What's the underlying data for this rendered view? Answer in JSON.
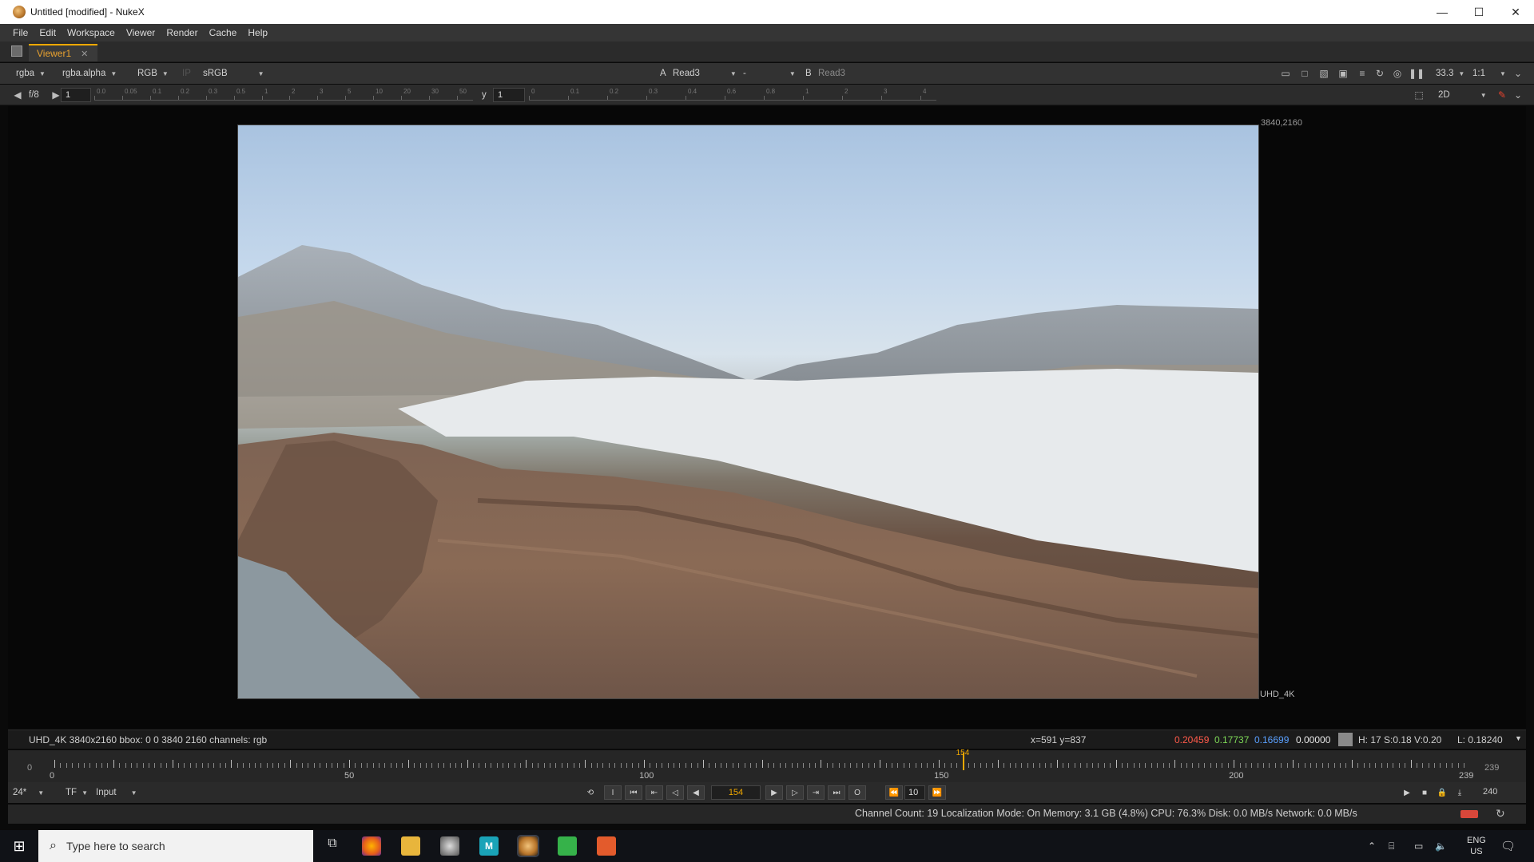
{
  "window": {
    "title": "Untitled [modified] - NukeX",
    "min": "—",
    "max": "☐",
    "close": "✕"
  },
  "menu": [
    "File",
    "Edit",
    "Workspace",
    "Viewer",
    "Render",
    "Cache",
    "Help"
  ],
  "tab": {
    "label": "Viewer1",
    "close": "✕"
  },
  "viewer_controls": {
    "channels": "rgba",
    "alpha": "rgba.alpha",
    "display": "RGB",
    "ip": "IP",
    "lut": "sRGB",
    "a_label": "A",
    "a_input": "Read3",
    "composite": "-",
    "b_label": "B",
    "b_input": "Read3",
    "zoom": "33.3",
    "ratio": "1:1",
    "mode": "2D"
  },
  "gamma": {
    "fstop": "f/8",
    "gain": "1",
    "y_label": "y",
    "gamma": "1",
    "gain_ticks": [
      "0.0",
      "0.05",
      "0.1",
      "0.2",
      "0.3",
      "0.5",
      "1",
      "2",
      "3",
      "5",
      "10",
      "20",
      "30",
      "50"
    ],
    "gamma_ticks": [
      "0",
      "0.1",
      "0.2",
      "0.3",
      "0.4",
      "0.6",
      "0.8",
      "1",
      "2",
      "3",
      "4"
    ]
  },
  "image": {
    "resolution_label": "3840,2160",
    "format_label": "UHD_4K"
  },
  "info": {
    "format": "UHD_4K 3840x2160  bbox: 0 0 3840 2160 channels: rgb",
    "coords": "x=591 y=837",
    "r": "0.20459",
    "g": "0.17737",
    "b": "0.16699",
    "a": "0.00000",
    "hsv": "H: 17 S:0.18 V:0.20",
    "luma": "L: 0.18240",
    "r_color": "#ff5a4a",
    "g_color": "#7ed957",
    "b_color": "#5aa0ff"
  },
  "timeline": {
    "start": "0",
    "end": "239",
    "current": "154",
    "out": "239",
    "labels": [
      "0",
      "50",
      "100",
      "150",
      "200",
      "239"
    ],
    "range": [
      0,
      239
    ]
  },
  "playback": {
    "fps": "24*",
    "tf": "TF",
    "input": "Input",
    "frame": "154",
    "step": "10",
    "end_frame": "240"
  },
  "status": "Channel Count: 19 Localization Mode: On Memory: 3.1 GB (4.8%) CPU: 76.3% Disk: 0.0 MB/s Network: 0.0 MB/s",
  "taskbar": {
    "search_placeholder": "Type here to search",
    "lang": "ENG",
    "region": "US"
  },
  "colors": {
    "accent": "#f0a800",
    "panel": "#2b2b2b",
    "viewer_bg": "#070707"
  }
}
